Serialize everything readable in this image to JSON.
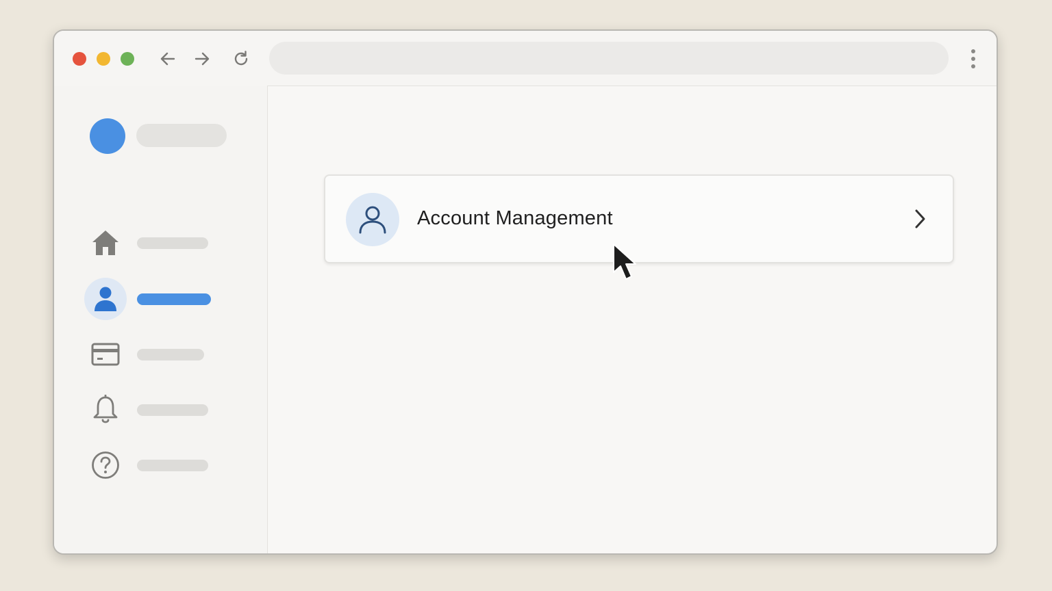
{
  "window": {
    "traffic_lights": [
      {
        "name": "close",
        "color": "#e5533d"
      },
      {
        "name": "minimize",
        "color": "#f2b731"
      },
      {
        "name": "maximize",
        "color": "#6db257"
      }
    ],
    "nav": {
      "back_icon": "arrow-left-icon",
      "forward_icon": "arrow-right-icon",
      "reload_icon": "reload-icon",
      "menu_icon": "kebab-menu-icon"
    },
    "address_bar": {
      "value": ""
    }
  },
  "sidebar": {
    "profile": {
      "avatar_color": "#4a90e2",
      "name": ""
    },
    "items": [
      {
        "icon": "home-icon",
        "label": "",
        "active": false
      },
      {
        "icon": "user-icon",
        "label": "",
        "active": true
      },
      {
        "icon": "credit-card-icon",
        "label": "",
        "active": false
      },
      {
        "icon": "bell-icon",
        "label": "",
        "active": false
      },
      {
        "icon": "help-icon",
        "label": "",
        "active": false
      }
    ]
  },
  "main": {
    "card": {
      "icon": "user-outline-icon",
      "title": "Account Management",
      "chevron_icon": "chevron-right-icon"
    }
  },
  "colors": {
    "accent": "#4a90e2",
    "background": "#ece7dc"
  }
}
